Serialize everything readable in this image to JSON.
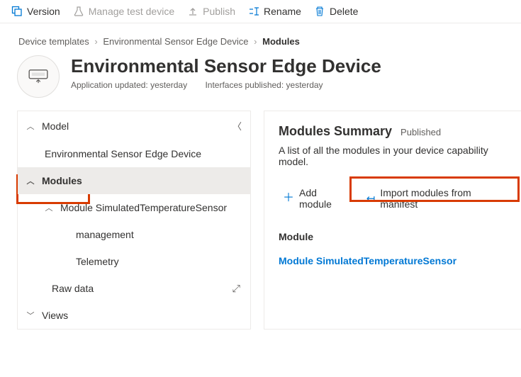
{
  "toolbar": {
    "version": "Version",
    "manage_test": "Manage test device",
    "publish": "Publish",
    "rename": "Rename",
    "delete": "Delete"
  },
  "breadcrumbs": {
    "root": "Device templates",
    "device": "Environmental Sensor Edge Device",
    "current": "Modules"
  },
  "header": {
    "title": "Environmental Sensor Edge Device",
    "app_updated": "Application updated: yesterday",
    "ifaces_published": "Interfaces published: yesterday"
  },
  "nav": {
    "model": "Model",
    "model_item": "Environmental Sensor Edge Device",
    "modules": "Modules",
    "module_sim": "Module SimulatedTemperatureSensor",
    "management": "management",
    "telemetry": "Telemetry",
    "raw_data": "Raw data",
    "views": "Views"
  },
  "summary": {
    "title": "Modules Summary",
    "status": "Published",
    "desc": "A list of all the modules in your device capability model.",
    "add_module": "Add module",
    "import": "Import modules from manifest",
    "module_label": "Module",
    "module_link": "Module SimulatedTemperatureSensor"
  }
}
